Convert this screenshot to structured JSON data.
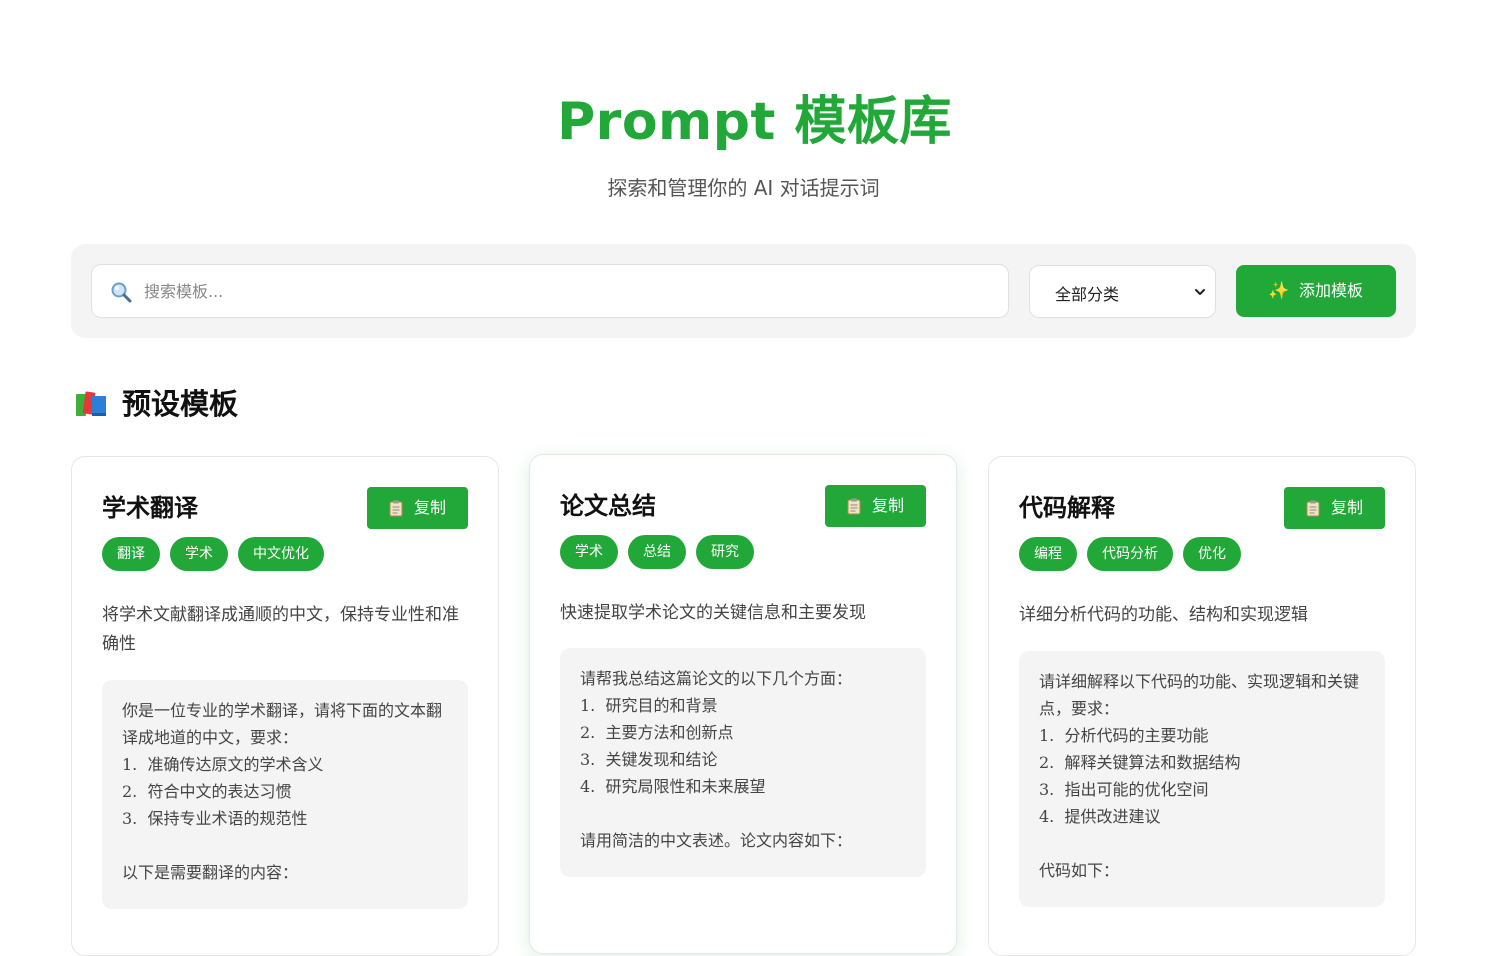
{
  "header": {
    "title": "Prompt 模板库",
    "subtitle": "探索和管理你的 AI 对话提示词"
  },
  "toolbar": {
    "search": {
      "placeholder": "搜索模板...",
      "icon": "search-icon"
    },
    "category": {
      "selected": "全部分类"
    },
    "add_button": {
      "icon": "sparkles-icon",
      "icon_glyph": "✨",
      "label": "添加模板"
    }
  },
  "section": {
    "icon": "books-icon",
    "title": "预设模板"
  },
  "colors": {
    "accent": "#22a838",
    "panel": "#f4f4f4"
  },
  "cards": [
    {
      "title": "学术翻译",
      "copy_label": "复制",
      "tags": [
        "翻译",
        "学术",
        "中文优化"
      ],
      "description": "将学术文献翻译成通顺的中文，保持专业性和准确性",
      "prompt": "你是一位专业的学术翻译，请将下面的文本翻译成地道的中文，要求：\n1.  准确传达原文的学术含义\n2.  符合中文的表达习惯\n3.  保持专业术语的规范性\n\n以下是需要翻译的内容："
    },
    {
      "title": "论文总结",
      "copy_label": "复制",
      "tags": [
        "学术",
        "总结",
        "研究"
      ],
      "description": "快速提取学术论文的关键信息和主要发现",
      "prompt": "请帮我总结这篇论文的以下几个方面：\n1.  研究目的和背景\n2.  主要方法和创新点\n3.  关键发现和结论\n4.  研究局限性和未来展望\n\n请用简洁的中文表述。论文内容如下："
    },
    {
      "title": "代码解释",
      "copy_label": "复制",
      "tags": [
        "编程",
        "代码分析",
        "优化"
      ],
      "description": "详细分析代码的功能、结构和实现逻辑",
      "prompt": "请详细解释以下代码的功能、实现逻辑和关键点，要求：\n1.  分析代码的主要功能\n2.  解释关键算法和数据结构\n3.  指出可能的优化空间\n4.  提供改进建议\n\n代码如下："
    }
  ]
}
